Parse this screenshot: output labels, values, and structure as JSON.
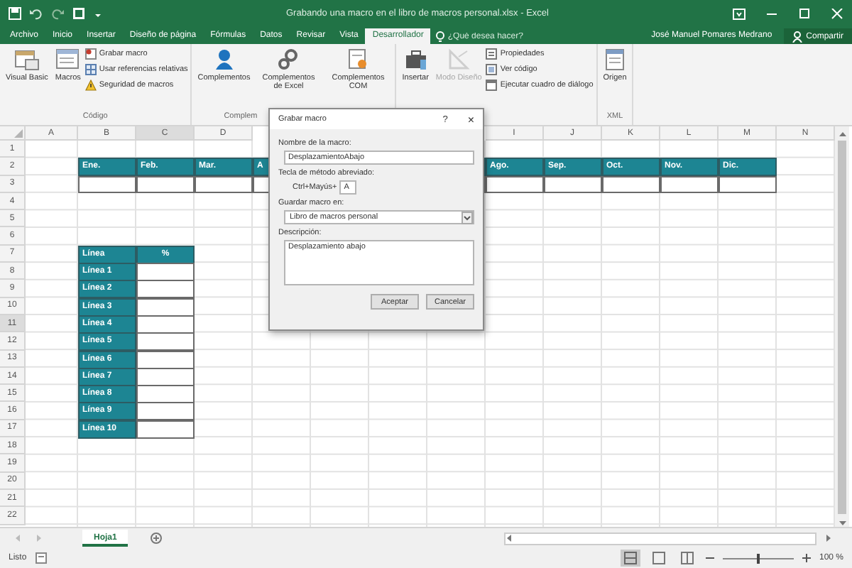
{
  "window": {
    "title": "Grabando una macro en el libro de macros personal.xlsx - Excel"
  },
  "ribbon_tabs": [
    {
      "label": "Archivo",
      "selected": false
    },
    {
      "label": "Inicio",
      "selected": false
    },
    {
      "label": "Insertar",
      "selected": false
    },
    {
      "label": "Diseño de página",
      "selected": false
    },
    {
      "label": "Fórmulas",
      "selected": false
    },
    {
      "label": "Datos",
      "selected": false
    },
    {
      "label": "Revisar",
      "selected": false
    },
    {
      "label": "Vista",
      "selected": false
    },
    {
      "label": "Desarrollador",
      "selected": true
    }
  ],
  "tell_me": {
    "placeholder": "¿Qué desea hacer?"
  },
  "user": "José Manuel Pomares Medrano",
  "share_button": "Compartir",
  "ribbon_groups": [
    {
      "label": "Código",
      "controls": [
        {
          "kind": "large",
          "label": "Visual Basic",
          "disabled": false
        },
        {
          "kind": "large",
          "label": "Macros",
          "disabled": false
        },
        {
          "kind": "small",
          "label": "Grabar macro",
          "disabled": false
        },
        {
          "kind": "small",
          "label": "Usar referencias relativas",
          "disabled": false
        },
        {
          "kind": "small",
          "label": "Seguridad de macros",
          "disabled": false
        }
      ]
    },
    {
      "label": "Complem",
      "controls": [
        {
          "kind": "large",
          "label": "Complementos",
          "disabled": false
        },
        {
          "kind": "large",
          "label": "Complementos de Excel",
          "disabled": false
        },
        {
          "kind": "large",
          "label": "Complementos COM",
          "disabled": false
        }
      ]
    },
    {
      "controls": [
        {
          "kind": "large",
          "label": "Insertar",
          "disabled": false
        },
        {
          "kind": "large",
          "label": "Modo Diseño",
          "disabled": true
        },
        {
          "kind": "small",
          "label": "Propiedades",
          "disabled": false
        },
        {
          "kind": "small",
          "label": "Ver código",
          "disabled": false
        },
        {
          "kind": "small",
          "label": "Ejecutar cuadro de diálogo",
          "disabled": false
        }
      ]
    },
    {
      "label": "XML",
      "controls": [
        {
          "kind": "large",
          "label": "Origen",
          "disabled": false
        }
      ]
    }
  ],
  "sheet": {
    "columns": [
      "A",
      "B",
      "C",
      "D",
      null,
      null,
      null,
      null,
      "I",
      "J",
      "K",
      "L",
      "M",
      "N"
    ],
    "rows": [
      "1",
      "2",
      "3",
      "4",
      "5",
      "6",
      "7",
      "8",
      "9",
      "10",
      "11",
      "12",
      "13",
      "14",
      "15",
      "16",
      "17",
      "18",
      "19",
      "20",
      "21",
      "22"
    ],
    "month_table": {
      "headers_left": [
        "Ene.",
        "Feb.",
        "Mar.",
        "A"
      ],
      "headers_right": [
        "Ago.",
        "Sep.",
        "Oct.",
        "Nov.",
        "Dic."
      ]
    },
    "line_table": {
      "headers": [
        "Línea",
        "%"
      ],
      "rows": [
        "Línea 1",
        "Línea 2",
        "Línea 3",
        "Línea 4",
        "Línea 5",
        "Línea 6",
        "Línea 7",
        "Línea 8",
        "Línea 9",
        "Línea 10"
      ]
    }
  },
  "dialog": {
    "title": "Grabar macro",
    "help": "?",
    "close": "×",
    "name_label": "Nombre de la macro:",
    "name_value": "DesplazamientoAbajo",
    "shortcut_label": "Tecla de método abreviado:",
    "shortcut_prefix": "Ctrl+Mayús+",
    "shortcut_value": "A",
    "store_label": "Guardar macro en:",
    "store_value": "Libro de macros personal",
    "description_label": "Descripción:",
    "description_value": "Desplazamiento abajo",
    "buttons": [
      "Aceptar",
      "Cancelar"
    ]
  },
  "sheet_tabs": [
    {
      "label": "Hoja1",
      "selected": true
    }
  ],
  "status_bar": {
    "text": "Listo",
    "zoom": {
      "level": 0.5,
      "reading": "100 %"
    }
  }
}
